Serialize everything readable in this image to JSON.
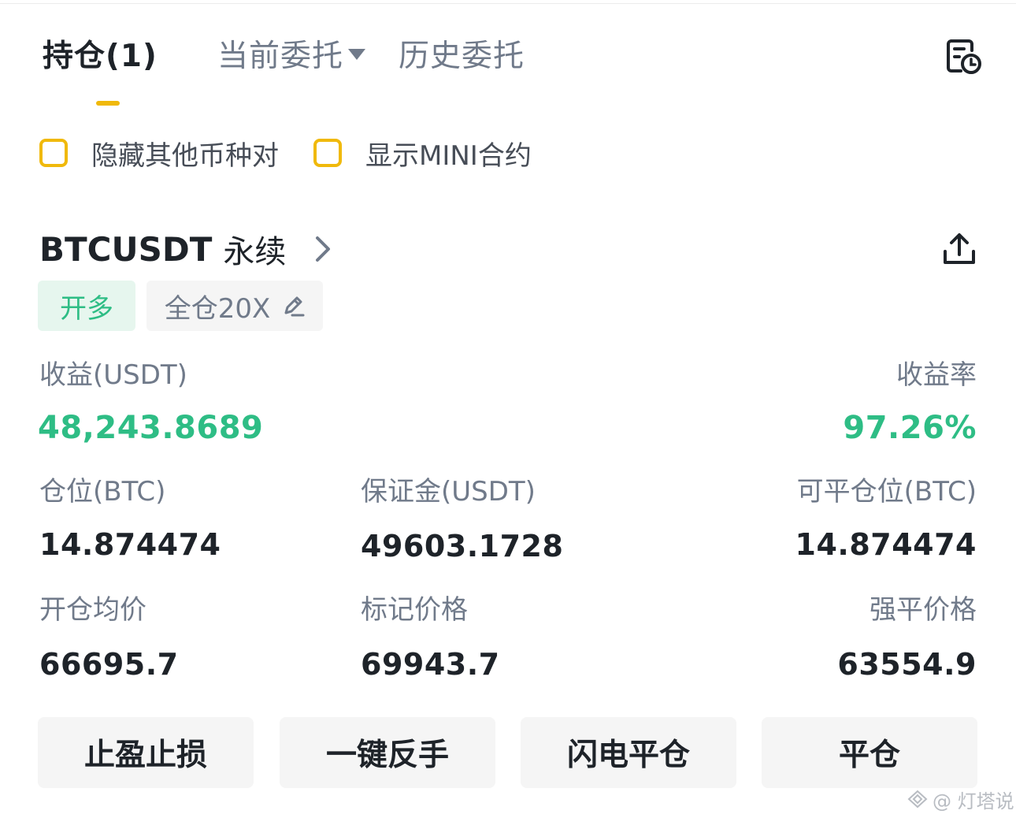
{
  "tabs": {
    "positions_label": "持仓(1)",
    "open_orders_label": "当前委托",
    "history_label": "历史委托"
  },
  "filters": {
    "hide_other_pairs_label": "隐藏其他币种对",
    "hide_other_pairs_checked": false,
    "show_mini_label": "显示MINI合约",
    "show_mini_checked": false
  },
  "position": {
    "symbol": "BTCUSDT",
    "contract_type": "永续",
    "side_label": "开多",
    "margin_mode_label": "全仓20X",
    "pnl_label": "收益(USDT)",
    "pnl_value": "48,243.8689",
    "roe_label": "收益率",
    "roe_value": "97.26%",
    "size_label": "仓位(BTC)",
    "size_value": "14.874474",
    "margin_label": "保证金(USDT)",
    "margin_value": "49603.1728",
    "closable_label": "可平仓位(BTC)",
    "closable_value": "14.874474",
    "entry_price_label": "开仓均价",
    "entry_price_value": "66695.7",
    "mark_price_label": "标记价格",
    "mark_price_value": "69943.7",
    "liq_price_label": "强平价格",
    "liq_price_value": "63554.9"
  },
  "actions": {
    "tp_sl_label": "止盈止损",
    "reverse_label": "一键反手",
    "flash_close_label": "闪电平仓",
    "close_label": "平仓"
  },
  "watermark": {
    "text": "@ 灯塔说"
  },
  "colors": {
    "accent": "#f0b90b",
    "profit": "#2ebd85",
    "long_badge_bg": "#e6f6ee",
    "muted_text": "#707a8a",
    "button_bg": "#f5f5f5"
  },
  "icons": {
    "history": "order-history-icon",
    "share": "share-icon",
    "chevron": "chevron-right-icon",
    "edit": "pencil-icon",
    "dropdown": "caret-down-icon"
  }
}
